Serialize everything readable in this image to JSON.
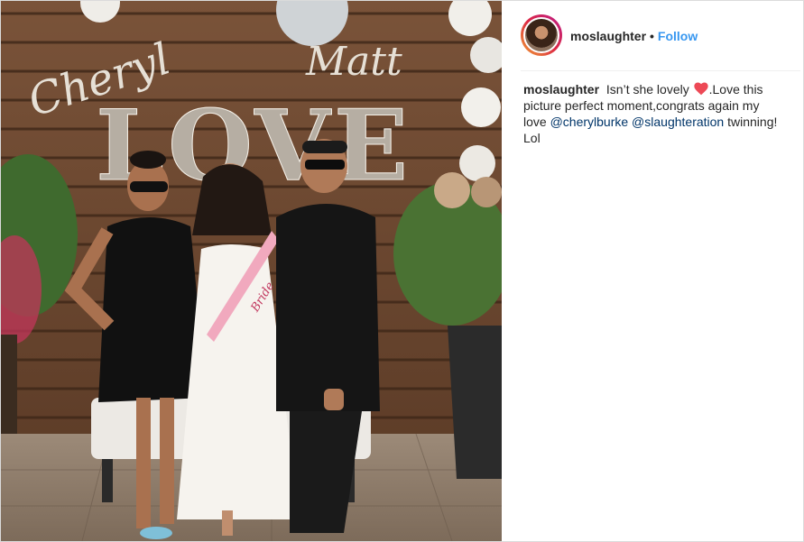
{
  "post": {
    "username": "moslaughter",
    "follow_label": "Follow",
    "separator": "•",
    "caption": {
      "username": "moslaughter",
      "text_part1": "Isn’t she lovely",
      "emoji_icon": "red-heart-icon",
      "text_part2": ".Love this picture perfect moment,congrats again my love",
      "mention_1": "@cherylburke",
      "mention_2": "@slaughteration",
      "text_part3": "twinning! Lol"
    }
  },
  "photo": {
    "sign_text_left": "Cheryl",
    "sign_text_right": "Matt",
    "sign_text_center": "LOVE",
    "sash_text": "Bride"
  },
  "colors": {
    "follow": "#3897f0",
    "mention": "#003569",
    "heart": "#ed4956"
  }
}
